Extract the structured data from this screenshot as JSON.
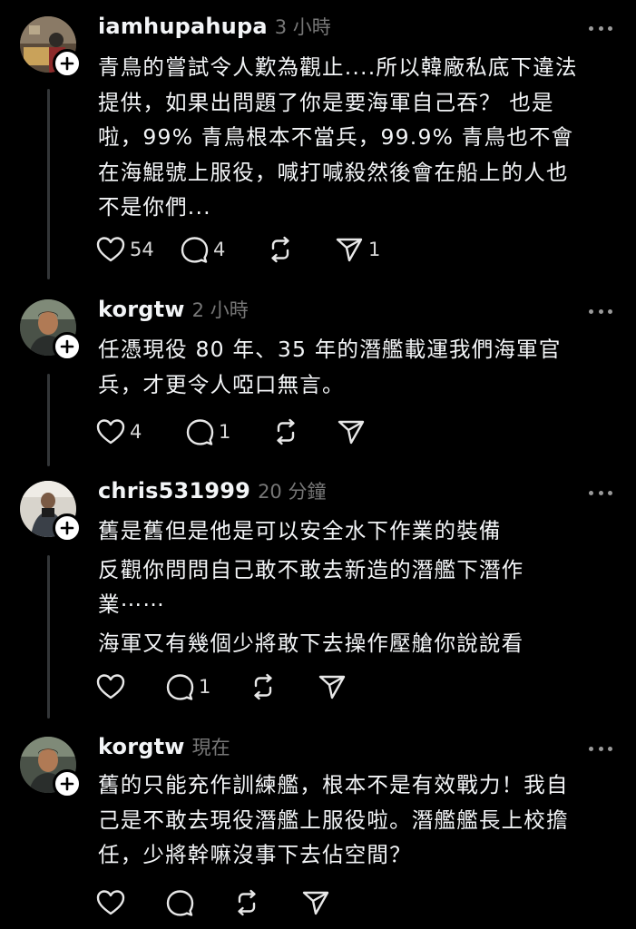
{
  "posts": [
    {
      "username": "iamhupahupa",
      "time": "3 小時",
      "lines": [
        "青鳥的嘗試令人歎為觀止....所以韓廠私底下違法",
        "提供，如果出問題了你是要海軍自己吞？ 也是",
        "啦，99% 青鳥根本不當兵，99.9% 青鳥也不會",
        "在海鯤號上服役，喊打喊殺然後會在船上的人也",
        "不是你們..."
      ],
      "likes": "54",
      "replies": "4",
      "reposts": "",
      "shares": "1"
    },
    {
      "username": "korgtw",
      "time": "2 小時",
      "lines": [
        "任憑現役 80 年、35 年的潛艦載運我們海軍官",
        "兵，才更令人啞口無言。"
      ],
      "likes": "4",
      "replies": "1",
      "reposts": "",
      "shares": ""
    },
    {
      "username": "chris531999",
      "time": "20 分鐘",
      "lines": [
        "舊是舊但是他是可以安全水下作業的裝備",
        "反觀你問問自己敢不敢去新造的潛艦下潛作",
        "業⋯⋯",
        "海軍又有幾個少將敢下去操作壓艙你說說看"
      ],
      "likes": "",
      "replies": "1",
      "reposts": "",
      "shares": ""
    },
    {
      "username": "korgtw",
      "time": "現在",
      "lines": [
        "舊的只能充作訓練艦，根本不是有效戰力！我自",
        "己是不敢去現役潛艦上服役啦。潛艦艦長上校擔",
        "任，少將幹嘛沒事下去佔空間？"
      ],
      "likes": "",
      "replies": "",
      "reposts": "",
      "shares": ""
    }
  ],
  "icons": {
    "like": "heart-icon",
    "reply": "comment-icon",
    "repost": "repost-icon",
    "share": "send-icon",
    "more": "more-icon",
    "follow": "plus-icon"
  },
  "colors": {
    "background": "#000000",
    "text": "#f3f5f7",
    "muted": "#777777",
    "thread_line": "#333638"
  }
}
